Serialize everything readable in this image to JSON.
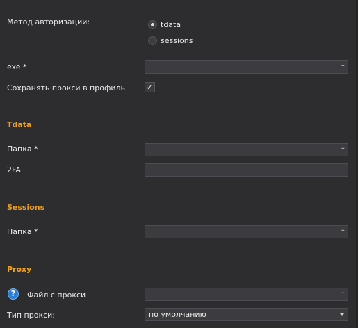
{
  "auth": {
    "label": "Метод авторизации:",
    "options": [
      {
        "label": "tdata",
        "checked": true
      },
      {
        "label": "sessions",
        "checked": false
      }
    ]
  },
  "exe": {
    "label": "exe *",
    "browse": "···",
    "value": ""
  },
  "save_proxy": {
    "label": "Сохранять прокси в профиль",
    "checked": true,
    "mark": "✓"
  },
  "tdata": {
    "title": "Tdata",
    "folder_label": "Папка *",
    "browse": "···",
    "twofa_label": "2FA"
  },
  "sessions": {
    "title": "Sessions",
    "folder_label": "Папка *",
    "browse": "···"
  },
  "proxy": {
    "title": "Proxy",
    "help": "?",
    "file_label": "Файл с прокси",
    "browse": "···",
    "type_label": "Тип прокси:",
    "type_value": "по умолчанию"
  },
  "colors": {
    "accent": "#f0a020",
    "background": "#2d2d30",
    "field": "#3c3c40",
    "help_icon": "#2a7fd4"
  }
}
